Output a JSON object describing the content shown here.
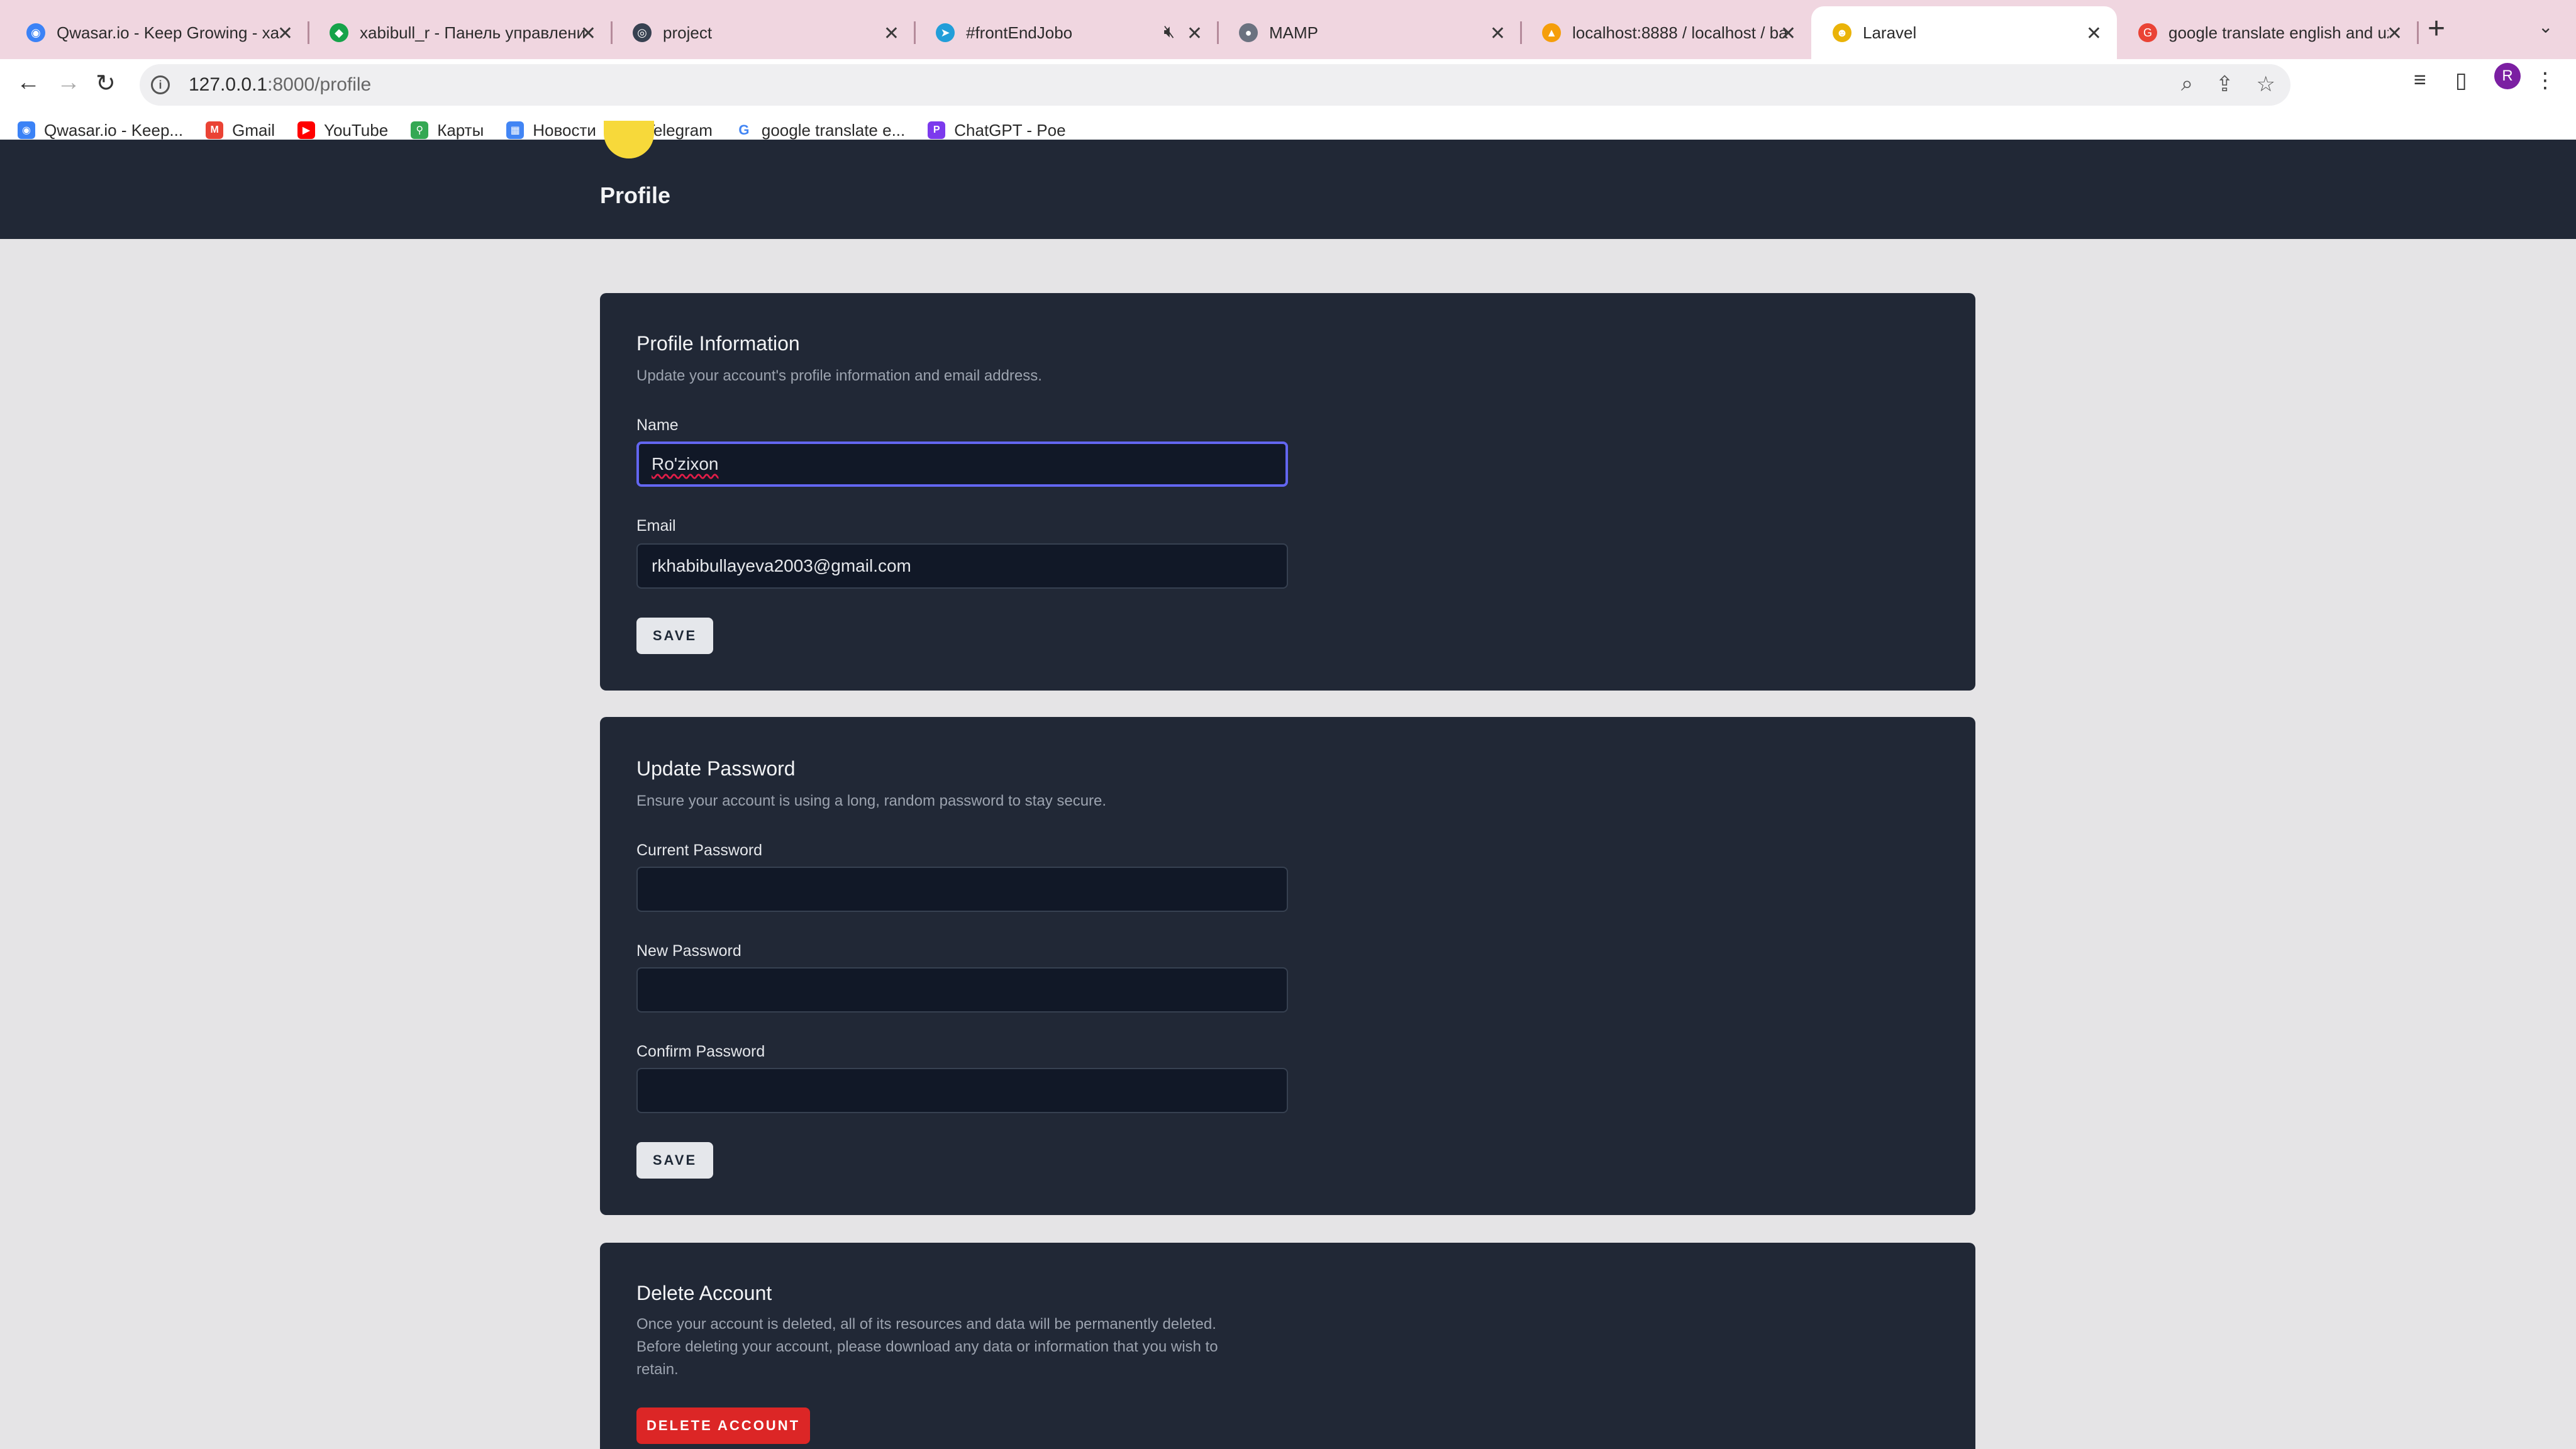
{
  "browser": {
    "tabs": [
      {
        "title": "Qwasar.io - Keep Growing - xa",
        "icon": "qwasar-icon",
        "color": "#3b82f6"
      },
      {
        "title": "xabibull_r - Панель управлени",
        "icon": "panel-icon",
        "color": "#16a34a"
      },
      {
        "title": "project",
        "icon": "globe-icon",
        "color": "#374151"
      },
      {
        "title": "#frontEndJobo",
        "icon": "telegram-icon",
        "color": "#229ed9"
      },
      {
        "title": "MAMP",
        "icon": "github-icon",
        "color": "#6b7280"
      },
      {
        "title": "localhost:8888 / localhost / ba",
        "icon": "phpmyadmin-icon",
        "color": "#f59e0b"
      },
      {
        "title": "Laravel",
        "icon": "laravel-icon",
        "color": "#eab308"
      },
      {
        "title": "google translate english and uz",
        "icon": "google-icon",
        "color": "#ea4335"
      }
    ],
    "url_host": "127.0.0.1",
    "url_path": ":8000/profile",
    "profile_initial": "R",
    "bookmarks": [
      {
        "label": "Qwasar.io - Keep...",
        "icon": "qwasar-icon",
        "color": "#3b82f6"
      },
      {
        "label": "Gmail",
        "icon": "gmail-icon",
        "color": "#ea4335"
      },
      {
        "label": "YouTube",
        "icon": "youtube-icon",
        "color": "#ff0000"
      },
      {
        "label": "Карты",
        "icon": "maps-icon",
        "color": "#34a853"
      },
      {
        "label": "Новости",
        "icon": "news-icon",
        "color": "#4285f4"
      },
      {
        "label": "Telegram",
        "icon": "telegram-icon",
        "color": "#229ed9"
      },
      {
        "label": "google translate e...",
        "icon": "google-icon",
        "color": "#4285f4"
      },
      {
        "label": "ChatGPT - Poe",
        "icon": "poe-icon",
        "color": "#7c3aed"
      }
    ]
  },
  "page": {
    "title": "Profile",
    "profile_info": {
      "heading": "Profile Information",
      "description": "Update your account's profile information and email address.",
      "name_label": "Name",
      "name_value": "Ro'zixon",
      "email_label": "Email",
      "email_value": "rkhabibullayeva2003@gmail.com",
      "save_label": "SAVE"
    },
    "update_password": {
      "heading": "Update Password",
      "description": "Ensure your account is using a long, random password to stay secure.",
      "current_label": "Current Password",
      "new_label": "New Password",
      "confirm_label": "Confirm Password",
      "save_label": "SAVE"
    },
    "delete_account": {
      "heading": "Delete Account",
      "description_line1": "Once your account is deleted, all of its resources and data will be permanently deleted.",
      "description_line2": "Before deleting your account, please download any data or information that you wish to",
      "description_line3": "retain.",
      "button_label": "DELETE ACCOUNT"
    }
  },
  "colors": {
    "header_bg": "#212836",
    "card_bg": "#212836",
    "page_bg": "#e5e4e6",
    "focus_ring": "#6366f1",
    "danger": "#dc2626"
  }
}
